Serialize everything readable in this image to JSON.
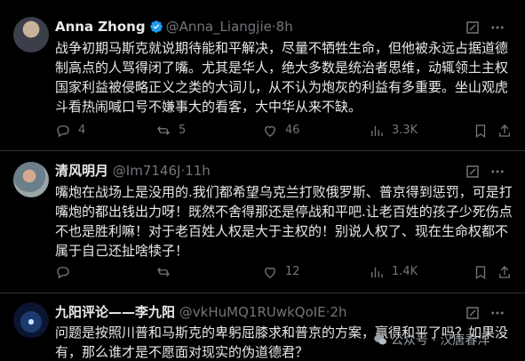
{
  "tweets": [
    {
      "name": "Anna Zhong",
      "handle": "@Anna_Liangjie",
      "sep": "·",
      "time": "8h",
      "verified": true,
      "lines": [
        "战争初期马斯克就说期待能和平解决，尽量不牺牲生命，但他被永远占据道德",
        "制高点的人骂得闭了嘴。尤其是华人，绝大多数是统治者思维，动辄领土主权",
        "国家利益被侵略正义之类的大词儿，从不认为炮灰的利益有多重要。坐山观虎",
        "斗看热闹喊口号不嫌事大的看客，大中华从来不缺。"
      ],
      "replies": "4",
      "reposts": "5",
      "likes": "46",
      "views": "3.3K"
    },
    {
      "name": "清风明月",
      "handle": "@Im7146J",
      "sep": "·",
      "time": "11h",
      "verified": false,
      "lines": [
        "嘴炮在战场上是没用的.我们都希望乌克兰打败俄罗斯、普京得到惩罚，可是打",
        "嘴炮的都出钱出力呀！既然不舍得那还是停战和平吧.让老百姓的孩子少死伤点",
        "不也是胜利嘛！对于老百姓人权是大于主权的！别说人权了、现在生命权都不",
        "属于自己还扯啥犊子！"
      ],
      "replies": "",
      "reposts": "",
      "likes": "12",
      "views": "1.4K"
    },
    {
      "name": "九阳评论——李九阳",
      "handle": "@vkHuMQ1RUwkQoIE",
      "sep": "·",
      "time": "2h",
      "verified": false,
      "lines": [
        "问题是按照川普和马斯克的卑躬屈膝求和普京的方案，赢得和平了吗？如果没",
        "有，那么谁才是不愿面对现实的伪道德君？"
      ]
    }
  ],
  "watermark": "公众号 · 汉唐春洋",
  "icons": [
    "verified-badge-icon",
    "grok-icon",
    "more-icon",
    "reply-icon",
    "repost-icon",
    "like-icon",
    "views-icon",
    "bookmark-icon",
    "share-icon"
  ],
  "colors": {
    "background": "#000000",
    "text": "#e7e9ea",
    "muted": "#71767b",
    "verified": "#1d9bf0",
    "divider": "#2f3336"
  }
}
